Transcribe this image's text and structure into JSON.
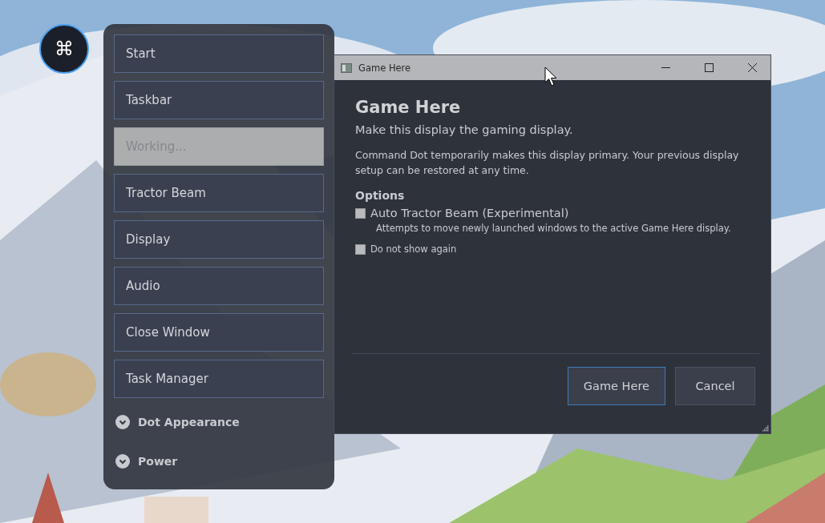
{
  "dot": {
    "glyph": "⌘"
  },
  "menu": {
    "items": [
      {
        "kind": "button",
        "label": "Start",
        "disabled": false
      },
      {
        "kind": "button",
        "label": "Taskbar",
        "disabled": false
      },
      {
        "kind": "button",
        "label": "Working...",
        "disabled": true
      },
      {
        "kind": "button",
        "label": "Tractor Beam",
        "disabled": false
      },
      {
        "kind": "button",
        "label": "Display",
        "disabled": false
      },
      {
        "kind": "button",
        "label": "Audio",
        "disabled": false
      },
      {
        "kind": "button",
        "label": "Close Window",
        "disabled": false
      },
      {
        "kind": "button",
        "label": "Task Manager",
        "disabled": false
      },
      {
        "kind": "section",
        "label": "Dot Appearance",
        "expanded": false
      },
      {
        "kind": "section",
        "label": "Power",
        "expanded": false
      }
    ]
  },
  "dialog": {
    "window": {
      "title": "Game Here"
    },
    "heading": "Game Here",
    "subtitle": "Make this display the gaming display.",
    "description": "Command Dot temporarily makes this display primary. Your previous display setup can be restored at any time.",
    "options_title": "Options",
    "options": [
      {
        "label": "Auto Tractor Beam (Experimental)",
        "checked": false,
        "hint": "Attempts to move newly launched windows to the active Game Here display."
      },
      {
        "label": "Do not show again",
        "checked": false
      }
    ],
    "buttons": [
      {
        "label": "Game Here",
        "default": true
      },
      {
        "label": "Cancel",
        "default": false
      }
    ]
  }
}
